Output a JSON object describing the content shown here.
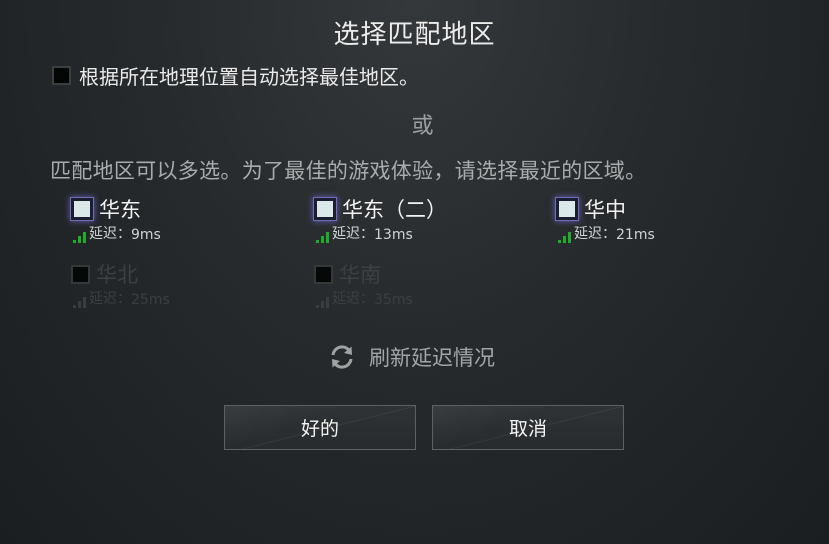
{
  "dialog": {
    "title": "选择匹配地区",
    "auto_select_label": "根据所在地理位置自动选择最佳地区。",
    "or_label": "或",
    "multi_select_hint": "匹配地区可以多选。为了最佳的游戏体验，请选择最近的区域。",
    "latency_label": "延迟：",
    "regions": [
      {
        "name": "华东",
        "latency": "9ms",
        "checked": true,
        "enabled": true
      },
      {
        "name": "华东（二）",
        "latency": "13ms",
        "checked": true,
        "enabled": true
      },
      {
        "name": "华中",
        "latency": "21ms",
        "checked": true,
        "enabled": true
      },
      {
        "name": "华北",
        "latency": "25ms",
        "checked": false,
        "enabled": false
      },
      {
        "name": "华南",
        "latency": "35ms",
        "checked": false,
        "enabled": false
      }
    ],
    "refresh_label": "刷新延迟情况",
    "ok_label": "好的",
    "cancel_label": "取消"
  },
  "colors": {
    "signal_green": "#1fae2a",
    "checkbox_glow": "#6f6db5",
    "text_primary": "#ececec",
    "text_muted": "#a9abac"
  },
  "icons": {
    "refresh": "refresh-icon",
    "signal": "signal-bars-icon"
  }
}
